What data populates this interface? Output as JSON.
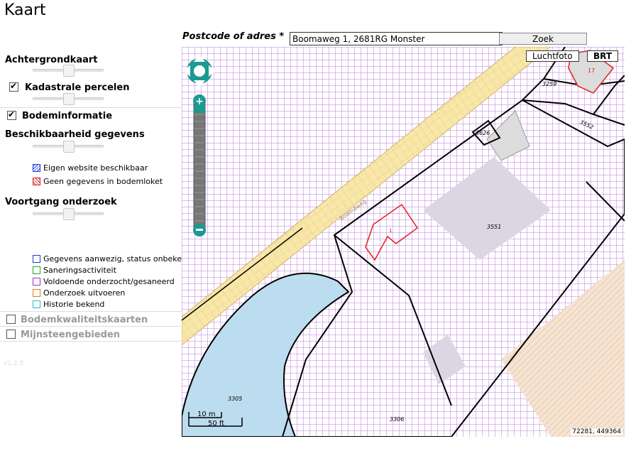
{
  "header": {
    "title": "Kaart"
  },
  "search": {
    "label": "Postcode of adres *",
    "value": "Boomaweg 1, 2681RG Monster",
    "button_label": "Zoek"
  },
  "sidebar": {
    "achtergrondkaart": {
      "label": "Achtergrondkaart",
      "slider_value": 0.5
    },
    "kadastrale_percelen": {
      "label": "Kadastrale percelen",
      "checked": true,
      "slider_value": 0.5
    },
    "bodeminformatie": {
      "label": "Bodeminformatie",
      "checked": true
    },
    "beschikbaarheid": {
      "label": "Beschikbaarheid gegevens",
      "slider_value": 0.5,
      "legend": [
        {
          "label": "Eigen website beschikbaar",
          "color": "#1a3bd0"
        },
        {
          "label": "Geen gegevens in bodemloket",
          "color": "#d02020"
        }
      ]
    },
    "voortgang": {
      "label": "Voortgang onderzoek",
      "slider_value": 0.5,
      "legend": [
        {
          "label": "Gegevens aanwezig, status onbekend",
          "color": "#1a3bd0"
        },
        {
          "label": "Saneringsactiviteit",
          "color": "#22aa22"
        },
        {
          "label": "Voldoende onderzocht/gesaneerd",
          "color": "#9b30d0"
        },
        {
          "label": "Onderzoek uitvoeren",
          "color": "#e07b1a"
        },
        {
          "label": "Historie bekend",
          "color": "#20c0c0"
        }
      ]
    },
    "bodemkwaliteitskaarten": {
      "label": "Bodemkwaliteitskaarten",
      "checked": false
    },
    "mijnsteengebieden": {
      "label": "Mijnsteengebieden",
      "checked": false
    },
    "version": "v1.2.5"
  },
  "map": {
    "buttons": {
      "luchtfoto": "Luchtfoto",
      "brt": "BRT"
    },
    "labels": {
      "street": "Boomaweg",
      "parcel_3259": "3259",
      "parcel_3552": "3552",
      "parcel_3626": "3626",
      "parcel_3551": "3551",
      "parcel_3305": "3305",
      "parcel_3306": "3306",
      "house_1": "1",
      "house_17": "17"
    },
    "scale": {
      "metric": "10 m",
      "imperial": "50 ft"
    },
    "coordinates": "72281, 449364",
    "colors": {
      "contaminated_purple": "#9b30d0",
      "investigate_orange": "#e07b1a",
      "road_yellow": "#f7e7a8",
      "water_blue": "#bcdcef",
      "building_gray": "#dcdcdc",
      "building_outline_red": "#e02020",
      "nav_teal": "#1a9a90"
    }
  }
}
